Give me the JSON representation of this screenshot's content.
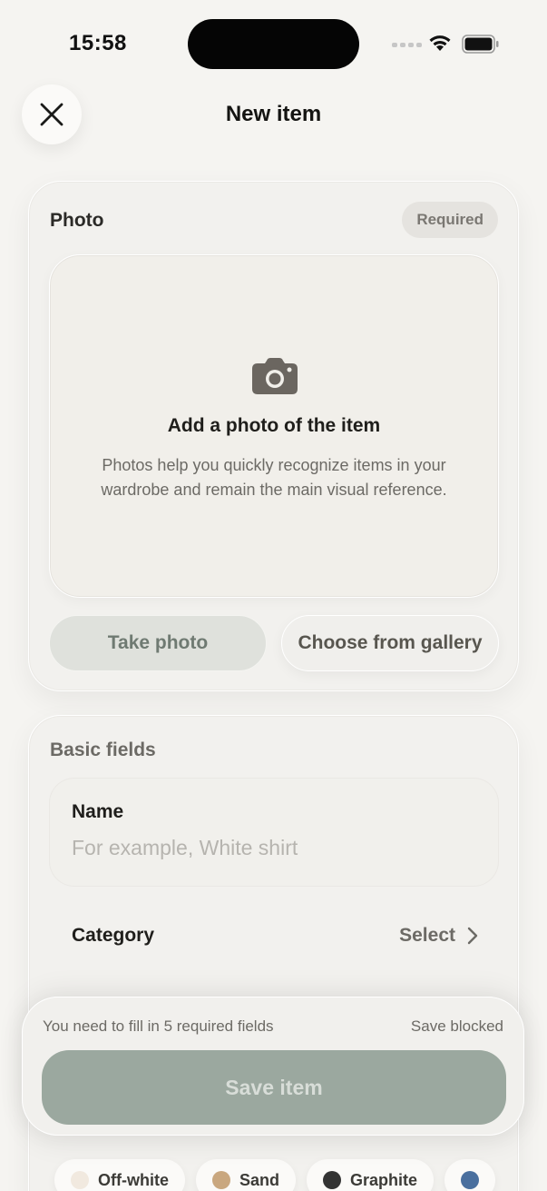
{
  "status_bar": {
    "time": "15:58"
  },
  "header": {
    "title": "New item"
  },
  "photo_section": {
    "label": "Photo",
    "badge": "Required",
    "empty_title": "Add a photo of the item",
    "empty_description": "Photos help you quickly recognize items in your wardrobe and remain the main visual reference.",
    "take_photo_label": "Take photo",
    "gallery_label": "Choose from gallery"
  },
  "basic_fields": {
    "label": "Basic fields",
    "name": {
      "label": "Name",
      "placeholder": "For example, White shirt",
      "value": ""
    },
    "category": {
      "label": "Category",
      "value": "Select"
    }
  },
  "save_panel": {
    "hint": "You need to fill in 5 required fields",
    "status": "Save blocked",
    "button_label": "Save item"
  },
  "color_chips": [
    {
      "label": "Off-white",
      "color": "#f1e9df"
    },
    {
      "label": "Sand",
      "color": "#c9a77f"
    },
    {
      "label": "Graphite",
      "color": "#333333"
    },
    {
      "label": "",
      "color": "#4a6f9e"
    }
  ],
  "colors": {
    "accent_disabled": "#9ba89f",
    "background": "#f5f4f1"
  }
}
